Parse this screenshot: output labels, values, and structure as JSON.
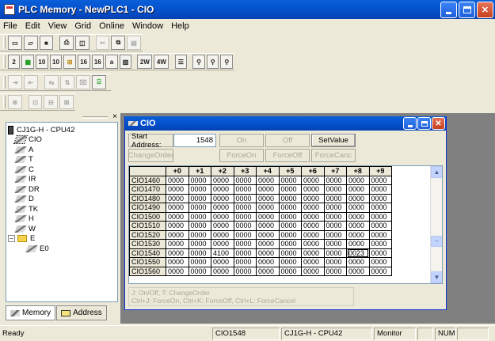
{
  "window": {
    "title": "PLC Memory - NewPLC1 - CIO"
  },
  "menu": [
    "File",
    "Edit",
    "View",
    "Grid",
    "Online",
    "Window",
    "Help"
  ],
  "toolbar_row2": [
    "2",
    "10",
    "10",
    "16",
    "16",
    "a",
    "2W",
    "4W"
  ],
  "tree": {
    "root": "CJ1G-H - CPU42",
    "items": [
      "CIO",
      "A",
      "T",
      "C",
      "IR",
      "DR",
      "D",
      "TK",
      "H",
      "W"
    ],
    "folder": {
      "label": "E",
      "expander": "−",
      "children": [
        "E0"
      ]
    }
  },
  "tabs": {
    "memory": "Memory",
    "address": "Address"
  },
  "cio_window": {
    "title": "CIO",
    "start_address_label": "Start Address:",
    "start_address_value": "1548",
    "buttons": {
      "on": "On",
      "off": "Off",
      "set_value": "SetValue",
      "change_order": "ChangeOrder",
      "force_on": "ForceOn",
      "force_off": "ForceOff",
      "force_cancel": "ForceCanc"
    },
    "columns": [
      "+0",
      "+1",
      "+2",
      "+3",
      "+4",
      "+5",
      "+6",
      "+7",
      "+8",
      "+9"
    ],
    "rows": [
      {
        "label": "CIO1460",
        "cells": [
          "0000",
          "0000",
          "0000",
          "0000",
          "0000",
          "0000",
          "0000",
          "0000",
          "0000",
          "0000"
        ]
      },
      {
        "label": "CIO1470",
        "cells": [
          "0000",
          "0000",
          "0000",
          "0000",
          "0000",
          "0000",
          "0000",
          "0000",
          "0000",
          "0000"
        ]
      },
      {
        "label": "CIO1480",
        "cells": [
          "0000",
          "0000",
          "0000",
          "0000",
          "0000",
          "0000",
          "0000",
          "0000",
          "0000",
          "0000"
        ]
      },
      {
        "label": "CIO1490",
        "cells": [
          "0000",
          "0000",
          "0000",
          "0000",
          "0000",
          "0000",
          "0000",
          "0000",
          "0000",
          "0000"
        ]
      },
      {
        "label": "CIO1500",
        "cells": [
          "0000",
          "0000",
          "0000",
          "0000",
          "0000",
          "0000",
          "0000",
          "0000",
          "0000",
          "0000"
        ]
      },
      {
        "label": "CIO1510",
        "cells": [
          "0000",
          "0000",
          "0000",
          "0000",
          "0000",
          "0000",
          "0000",
          "0000",
          "0000",
          "0000"
        ]
      },
      {
        "label": "CIO1520",
        "cells": [
          "0000",
          "0000",
          "0000",
          "0000",
          "0000",
          "0000",
          "0000",
          "0000",
          "0000",
          "0000"
        ]
      },
      {
        "label": "CIO1530",
        "cells": [
          "0000",
          "0000",
          "0000",
          "0000",
          "0000",
          "0000",
          "0000",
          "0000",
          "0000",
          "0000"
        ]
      },
      {
        "label": "CIO1540",
        "cells": [
          "0000",
          "0000",
          "4100",
          "0000",
          "0000",
          "0000",
          "0000",
          "0000",
          "0023",
          "0000"
        ]
      },
      {
        "label": "CIO1550",
        "cells": [
          "0000",
          "0000",
          "0000",
          "0000",
          "0000",
          "0000",
          "0000",
          "0000",
          "0000",
          "0000"
        ]
      },
      {
        "label": "CIO1560",
        "cells": [
          "0000",
          "0000",
          "0000",
          "0000",
          "0000",
          "0000",
          "0000",
          "0000",
          "0000",
          "0000"
        ]
      }
    ],
    "selected": {
      "row": 8,
      "col": 8
    },
    "help_line1": "J: On/Off,  T: ChangeOrder",
    "help_line2": "Ctrl+J: ForceOn,  Ctrl+K: ForceOff,  Ctrl+L: ForceCancel"
  },
  "status": {
    "ready": "Ready",
    "address": "CIO1548",
    "plc": "CJ1G-H - CPU42",
    "mode": "Monitor",
    "num": "NUM"
  }
}
